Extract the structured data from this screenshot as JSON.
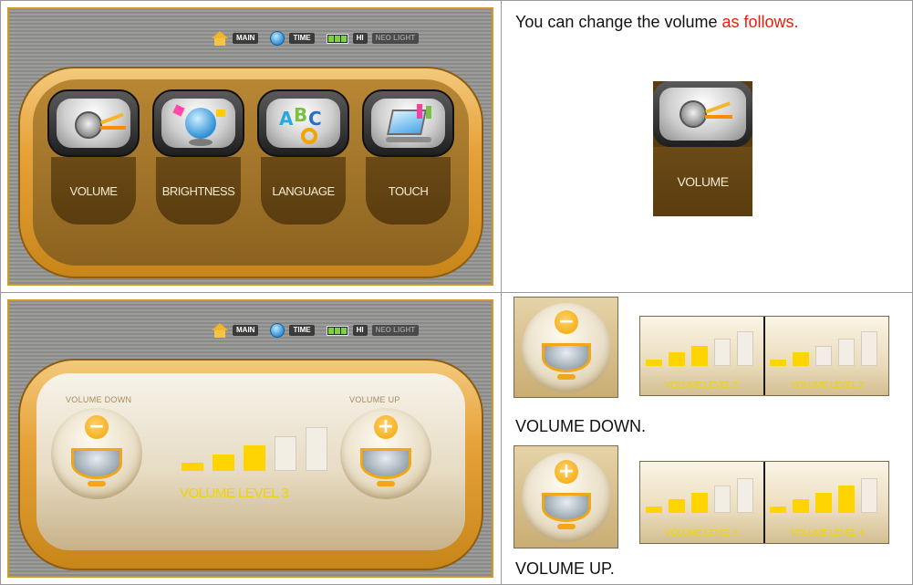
{
  "status_bar": {
    "main": "MAIN",
    "time": "TIME",
    "hi": "HI",
    "tail": "NEO LIGHT"
  },
  "menu_tiles": [
    {
      "label": "VOLUME",
      "icon": "speaker-icon"
    },
    {
      "label": "BRIGHTNESS",
      "icon": "globe-icon"
    },
    {
      "label": "LANGUAGE",
      "icon": "abc-icon"
    },
    {
      "label": "TOUCH",
      "icon": "touch-icon"
    }
  ],
  "intro": {
    "text": "You can change the volume ",
    "highlight": "as follows."
  },
  "preview_label": "VOLUME",
  "volume_screen": {
    "down_caption": "VOLUME DOWN",
    "up_caption": "VOLUME UP",
    "level_text": "VOLUME LEVEL 3",
    "level": 3,
    "max_level": 5
  },
  "down_example": {
    "before": {
      "label": "VOLUME LEVEL 3",
      "level": 3
    },
    "after": {
      "label": "VOLUME LEVEL 2",
      "level": 2
    },
    "caption": "VOLUME DOWN."
  },
  "up_example": {
    "before": {
      "label": "VOLUME LEVEL 3",
      "level": 3
    },
    "after": {
      "label": "VOLUME LEVEL 4",
      "level": 4
    },
    "caption": "VOLUME UP."
  },
  "colors": {
    "accent_red": "#e8200b",
    "gold": "#e6a23a",
    "level_on": "#ffd400"
  }
}
